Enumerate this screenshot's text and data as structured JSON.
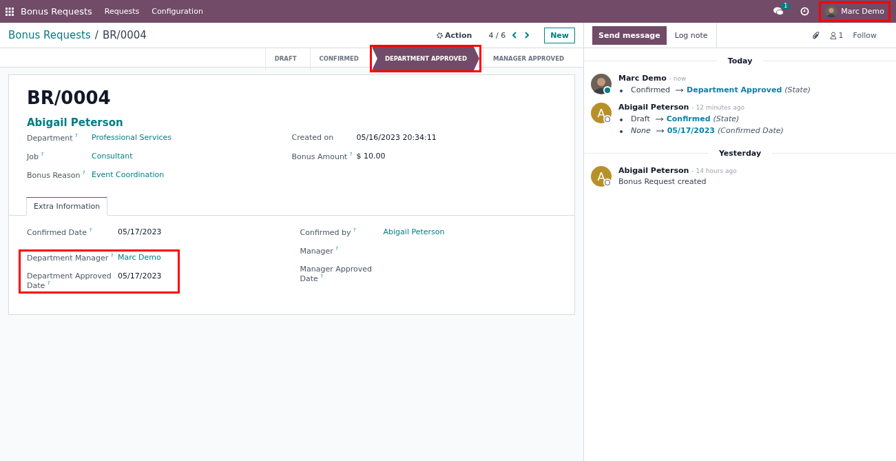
{
  "navbar": {
    "app_title": "Bonus Requests",
    "menu": [
      "Requests",
      "Configuration"
    ],
    "messages_badge": "1",
    "user": {
      "name": "Marc Demo",
      "highlighted": true
    }
  },
  "breadcrumb": {
    "parent": "Bonus Requests",
    "separator": "/",
    "current": "BR/0004"
  },
  "pager": {
    "action": "Action",
    "position": "4 / 6",
    "new_button": "New"
  },
  "stages": [
    {
      "label": "DRAFT",
      "selected": false,
      "highlighted": false
    },
    {
      "label": "CONFIRMED",
      "selected": false,
      "highlighted": false
    },
    {
      "label": "DEPARTMENT APPROVED",
      "selected": true,
      "highlighted": true
    },
    {
      "label": "MANAGER APPROVED",
      "selected": false,
      "highlighted": false
    }
  ],
  "record": {
    "title": "BR/0004",
    "employee": "Abigail Peterson",
    "left_fields": [
      {
        "label": "Department $^{?}$",
        "value": "Professional Services",
        "link": true
      },
      {
        "label": "Job $^{?}$",
        "value": "Consultant",
        "link": true
      },
      {
        "label": "Bonus Reason $^{?}$",
        "value": "Event Coordination",
        "link": true
      }
    ],
    "right_fields": [
      {
        "label": "Created on",
        "value": "05/16/2023 20:34:11",
        "link": false
      },
      {
        "label": "Bonus Amount $^{?}$",
        "value": "$ 10.00",
        "link": false
      }
    ]
  },
  "tabs": [
    {
      "label": "Extra Information",
      "selected": true
    }
  ],
  "extra_info": {
    "left_groups": [
      {
        "highlighted": false,
        "fields": [
          {
            "label": "Confirmed Date $^{?}$",
            "value": "05/17/2023",
            "link": false
          }
        ]
      },
      {
        "highlighted": true,
        "fields": [
          {
            "label": "Department Manager $^{?}$",
            "value": "Marc Demo",
            "link": true
          },
          {
            "label": "Department Approved Date $^{?}$",
            "value": "05/17/2023",
            "link": false
          }
        ]
      }
    ],
    "right_groups": [
      {
        "highlighted": false,
        "fields": [
          {
            "label": "Confirmed by $^{?}$",
            "value": "Abigail Peterson",
            "link": true
          },
          {
            "label": "Manager $^{?}$"
          },
          {
            "label": "Manager Approved Date $^{?}$"
          }
        ]
      }
    ]
  },
  "chatter": {
    "send_message": "Send message",
    "log_note": "Log note",
    "followers": "1",
    "follow": "Follow",
    "days": [
      {
        "label": "Today",
        "messages": [
          {
            "author": "Marc Demo",
            "time": "- now",
            "avatar": {
              "kind": "photo",
              "online": true
            },
            "changes": [
              {
                "old": "Confirmed",
                "old_empty": false,
                "new": "Department Approved",
                "field": "(State)"
              }
            ]
          },
          {
            "author": "Abigail Peterson",
            "time": "- 12 minutes ago",
            "avatar": {
              "kind": "letter",
              "letter": "A",
              "online": false
            },
            "changes": [
              {
                "old": "Draft",
                "old_empty": false,
                "new": "Confirmed",
                "field": "(State)"
              },
              {
                "old": "None",
                "old_empty": true,
                "new": "05/17/2023",
                "field": "(Confirmed Date)"
              }
            ]
          }
        ]
      },
      {
        "label": "Yesterday",
        "messages": [
          {
            "author": "Abigail Peterson",
            "time": "- 14 hours ago",
            "avatar": {
              "kind": "letter",
              "letter": "A",
              "online": false
            },
            "body": "Bonus Request created"
          }
        ]
      }
    ]
  }
}
